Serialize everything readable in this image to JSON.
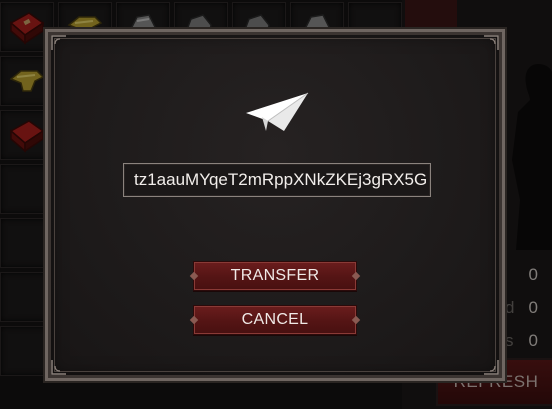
{
  "modal": {
    "address_value": "tz1aauMYqeT2mRppXNkZKEj3gRX5G",
    "transfer_label": "TRANSFER",
    "cancel_label": "CANCEL",
    "icon": "paper-plane-icon"
  },
  "background": {
    "stats": [
      "0",
      "0",
      "0"
    ],
    "stat_label_fragments": [
      "d",
      "s"
    ],
    "refresh_label": "REFRESH",
    "items": [
      "red-book-icon",
      "gold-anvil-icon",
      "grey-gauntlet-icon",
      "grey-gauntlet-icon",
      "grey-gauntlet-icon",
      "grey-gauntlet-icon",
      "gold-anvil-icon",
      "red-book-icon"
    ]
  },
  "colors": {
    "button_red": "#561515",
    "frame": "#6f6661",
    "text": "#f0e9e6"
  }
}
